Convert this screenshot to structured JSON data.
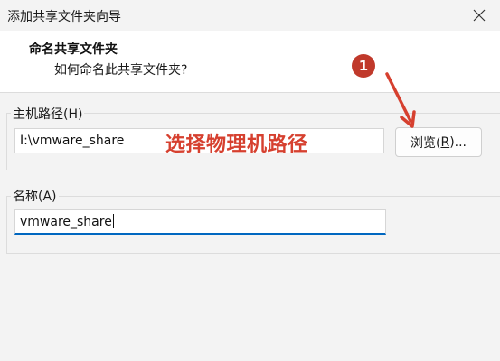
{
  "window": {
    "title": "添加共享文件夹向导"
  },
  "header": {
    "title": "命名共享文件夹",
    "subtitle": "如何命名此共享文件夹?"
  },
  "host_path": {
    "label": "主机路径(H)",
    "value": "I:\\vmware_share",
    "browse_label_prefix": "浏览(",
    "browse_label_key": "R",
    "browse_label_suffix": ")..."
  },
  "name": {
    "label": "名称(A)",
    "value": "vmware_share"
  },
  "annotation": {
    "text": "选择物理机路径",
    "badge": "1",
    "color": "#d6402f"
  },
  "colors": {
    "accent": "#0067c0",
    "badge": "#c0392b"
  }
}
